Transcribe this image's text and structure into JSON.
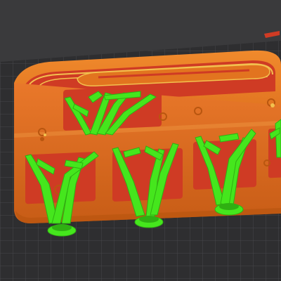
{
  "view": {
    "kind": "slicer-3d-preview",
    "object": "elongated-tray-with-tree-supports"
  },
  "colors": {
    "background": "#3a3a3c",
    "bed_plate": "#2e2e30",
    "bed_grid": "#4a4a4d",
    "model_body": "#e2741f",
    "model_shadow": "#b9560f",
    "model_highlight": "#f3a24b",
    "infill": "#cf3b24",
    "perimeter_yellow": "#f2c14e",
    "support_green": "#45e61d",
    "support_dark": "#2fb012"
  },
  "supports": {
    "count": 6,
    "type": "tree"
  }
}
